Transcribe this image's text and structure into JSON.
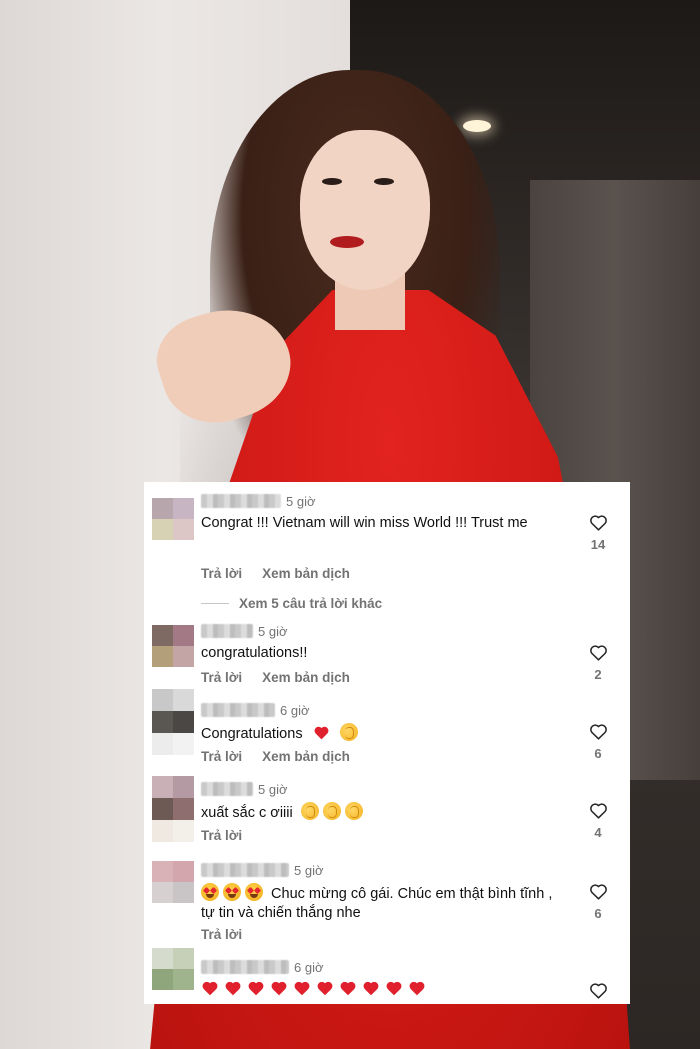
{
  "comments": [
    {
      "time": "5 giờ",
      "text": "Congrat !!! Vietnam will win miss World !!! Trust me",
      "reply_label": "Trả lời",
      "translate_label": "Xem bản dịch",
      "likes": "14",
      "view_replies": "Xem 5 câu trả lời khác",
      "avatar_colors": [
        "#b7a7ac",
        "#c8b5c4",
        "#d8d2b4",
        "#ddc7c6"
      ]
    },
    {
      "time": "5 giờ",
      "text": "congratulations!!",
      "reply_label": "Trả lời",
      "translate_label": "Xem bản dịch",
      "likes": "2",
      "avatar_colors": [
        "#7e6a63",
        "#a27984",
        "#b39f7a",
        "#c2a5a4"
      ]
    },
    {
      "time": "6 giờ",
      "text": "Congratulations",
      "reply_label": "Trả lời",
      "translate_label": "Xem bản dịch",
      "likes": "6",
      "avatar_colors": [
        "#c8c8c8",
        "#d9d9d9",
        "#5a5652",
        "#4a4744",
        "#ececec",
        "#f2f2f2"
      ]
    },
    {
      "time": "5 giờ",
      "text": "xuất sắc c ơiiii",
      "reply_label": "Trả lời",
      "likes": "4",
      "avatar_colors": [
        "#c9b0b6",
        "#b49aa3",
        "#6d5a54",
        "#8e6e6f",
        "#efe9e2",
        "#f3efe9"
      ]
    },
    {
      "time": "5 giờ",
      "text": "Chuc mừng cô gái. Chúc em thật bình tĩnh , tự tin và chiến thắng nhe",
      "reply_label": "Trả lời",
      "likes": "6",
      "avatar_colors": [
        "#d9b2b7",
        "#d3a6ae",
        "#d6d0d0",
        "#c9c4c6"
      ]
    },
    {
      "time": "6 giờ",
      "avatar_colors": [
        "#d6dccd",
        "#c6d0b8",
        "#8fa67c",
        "#9fb38c"
      ]
    }
  ],
  "colors": {
    "dress": "#d41f1b",
    "muted_text": "#737373",
    "primary_text": "#111111",
    "heart_red": "#e0202d"
  },
  "icons": [
    "heart-outline-icon",
    "red-heart-emoji",
    "clapping-hands-emoji",
    "heart-eyes-emoji"
  ]
}
